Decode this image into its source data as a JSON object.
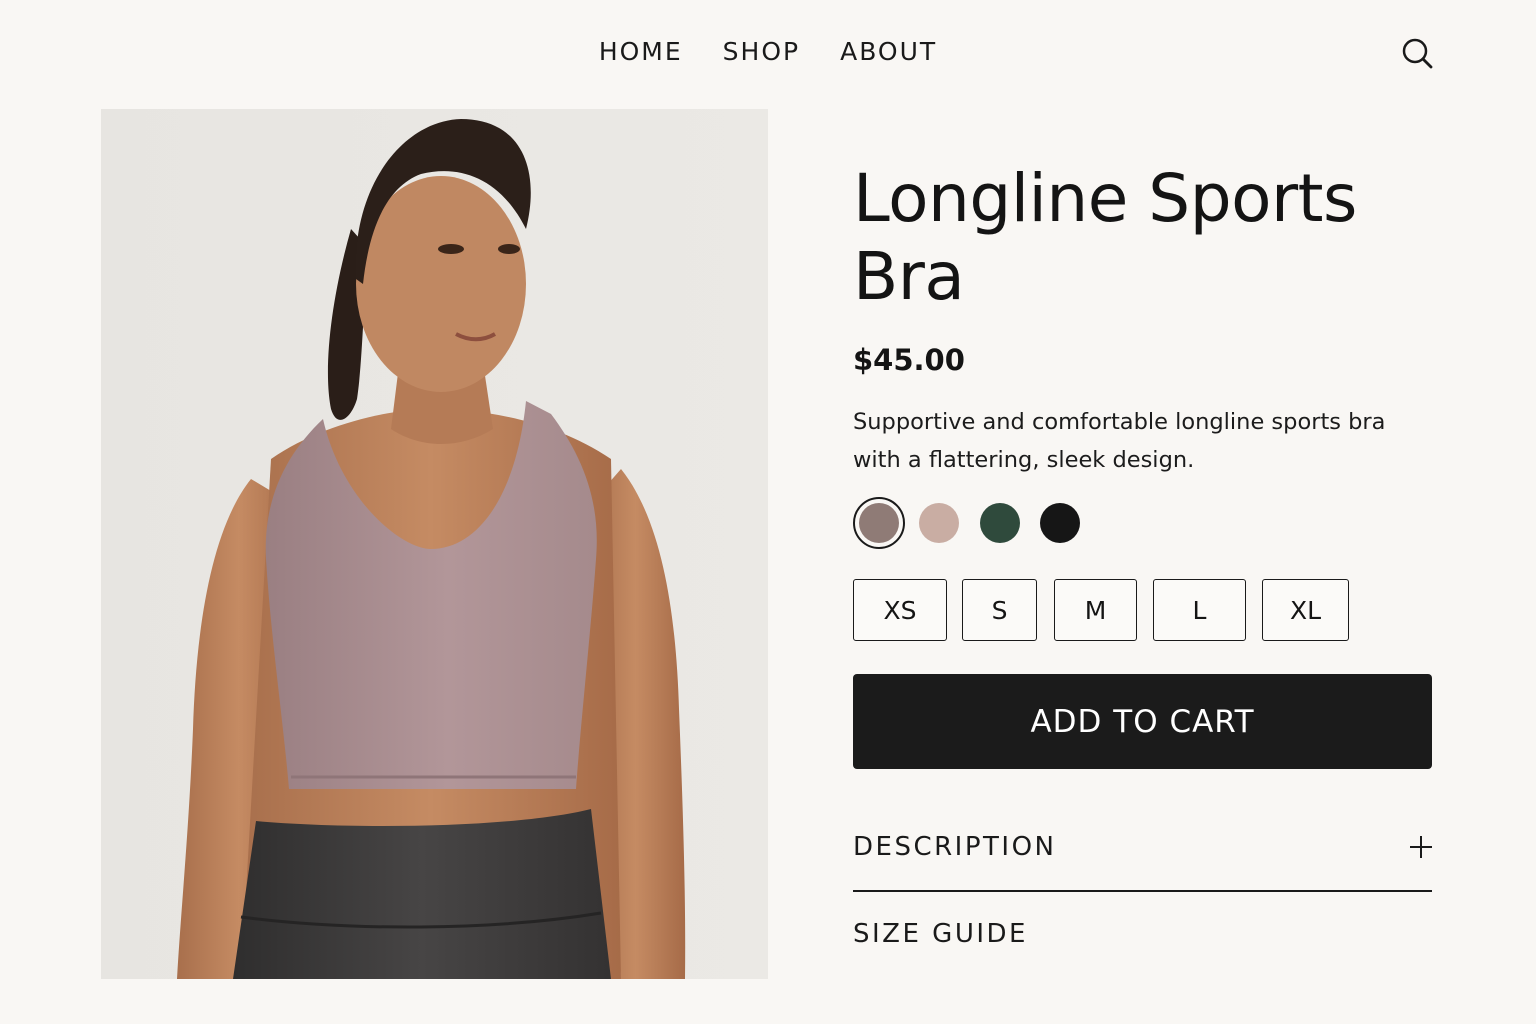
{
  "nav": {
    "items": [
      {
        "label": "HOME"
      },
      {
        "label": "SHOP"
      },
      {
        "label": "ABOUT"
      }
    ],
    "search_icon": "search-icon"
  },
  "product": {
    "image": "Woman wearing mauve longline sports bra and dark gray leggings",
    "title": "Longline Sports Bra",
    "price": "$45.00",
    "description": "Supportive and comfortable longline sports bra with a flattering, sleek design.",
    "colors": [
      {
        "name": "mauve",
        "hex": "#8f7b76",
        "selected": true
      },
      {
        "name": "blush",
        "hex": "#c9ada3",
        "selected": false
      },
      {
        "name": "forest green",
        "hex": "#2f4a3c",
        "selected": false
      },
      {
        "name": "black",
        "hex": "#161616",
        "selected": false
      }
    ],
    "sizes": [
      "XS",
      "S",
      "M",
      "L",
      "XL"
    ],
    "add_to_cart_label": "ADD TO CART"
  },
  "accordion": {
    "description_label": "DESCRIPTION",
    "size_guide_label": "SIZE GUIDE"
  },
  "colors": {
    "background": "#f9f7f4",
    "text": "#141414",
    "button": "#1b1b1b",
    "bra": "#ae9090",
    "leggings": "#3b3a3a"
  }
}
